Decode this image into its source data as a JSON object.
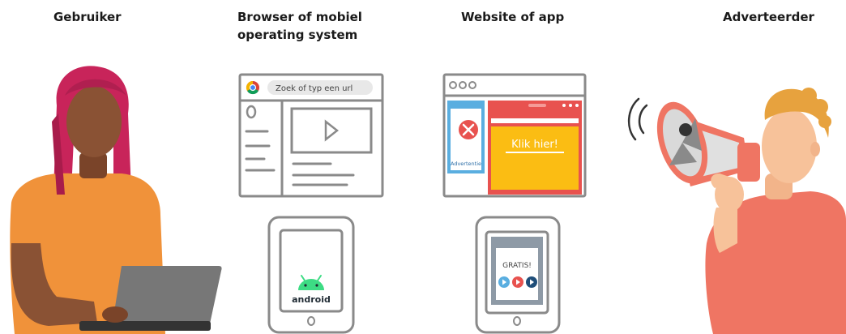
{
  "headings": {
    "user": "Gebruiker",
    "browser_line1": "Browser of mobiel",
    "browser_line2": "operating system",
    "website": "Website of app",
    "advertiser": "Adverteerder"
  },
  "browser_window": {
    "search_placeholder": "Zoek of typ een url"
  },
  "phone_android": {
    "os_label": "android"
  },
  "website_window": {
    "ad_label": "Advertentie",
    "cta_label": "Klik hier!"
  },
  "phone_app": {
    "promo_label": "GRATIS!"
  },
  "colors": {
    "skin_dark": "#8a5234",
    "hair_magenta": "#c8245a",
    "shirt_orange": "#f0923a",
    "laptop_gray": "#777777",
    "ad_red": "#e8524f",
    "ad_yellow": "#fbbd13",
    "sidebar_blue": "#5aaee0",
    "advertiser_shirt": "#ef7563",
    "advertiser_skin": "#f7c29a",
    "advertiser_hair": "#e7a23e",
    "android_green": "#3ddc84"
  }
}
